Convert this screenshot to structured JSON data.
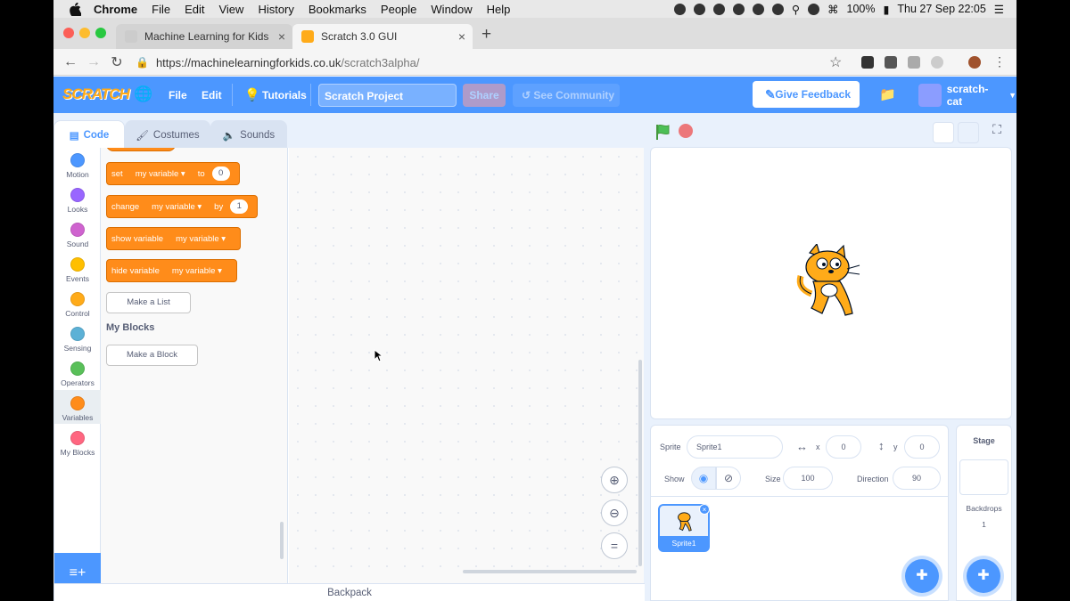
{
  "os_menubar": {
    "app": "Chrome",
    "items": [
      "File",
      "Edit",
      "View",
      "History",
      "Bookmarks",
      "People",
      "Window",
      "Help"
    ],
    "battery": "100%",
    "datetime": "Thu 27 Sep  22:05"
  },
  "browser": {
    "tabs": [
      {
        "title": "Machine Learning for Kids",
        "active": false
      },
      {
        "title": "Scratch 3.0 GUI",
        "active": true
      }
    ],
    "url_host": "https://machinelearningforkids.co.uk",
    "url_path": "/scratch3alpha/"
  },
  "scratch_menu": {
    "logo": "SCRATCH",
    "file": "File",
    "edit": "Edit",
    "tutorials": "Tutorials",
    "project_title": "Scratch Project",
    "share": "Share",
    "see_community": "See Community",
    "give_feedback": "Give Feedback",
    "username": "scratch-cat"
  },
  "editor_tabs": {
    "code": "Code",
    "costumes": "Costumes",
    "sounds": "Sounds"
  },
  "categories": [
    {
      "label": "Motion",
      "color": "#4c97ff"
    },
    {
      "label": "Looks",
      "color": "#9966ff"
    },
    {
      "label": "Sound",
      "color": "#cf63cf"
    },
    {
      "label": "Events",
      "color": "#ffbf00"
    },
    {
      "label": "Control",
      "color": "#ffab19"
    },
    {
      "label": "Sensing",
      "color": "#5cb1d6"
    },
    {
      "label": "Operators",
      "color": "#59c059"
    },
    {
      "label": "Variables",
      "color": "#ff8c1a"
    },
    {
      "label": "My Blocks",
      "color": "#ff6680"
    }
  ],
  "blocks": {
    "set": {
      "verb": "set",
      "var": "my variable",
      "prep": "to",
      "value": "0"
    },
    "change": {
      "verb": "change",
      "var": "my variable",
      "prep": "by",
      "value": "1"
    },
    "show": {
      "verb": "show variable",
      "var": "my variable"
    },
    "hide": {
      "verb": "hide variable",
      "var": "my variable"
    },
    "make_list": "Make a List",
    "my_blocks_heading": "My Blocks",
    "make_block": "Make a Block"
  },
  "backpack": "Backpack",
  "sprite_info": {
    "sprite_label": "Sprite",
    "sprite_name": "Sprite1",
    "x_label": "x",
    "x": "0",
    "y_label": "y",
    "y": "0",
    "show_label": "Show",
    "size_label": "Size",
    "size": "100",
    "direction_label": "Direction",
    "direction": "90"
  },
  "sprites": [
    {
      "name": "Sprite1"
    }
  ],
  "stage_panel": {
    "title": "Stage",
    "backdrops_label": "Backdrops",
    "backdrops_count": "1"
  }
}
